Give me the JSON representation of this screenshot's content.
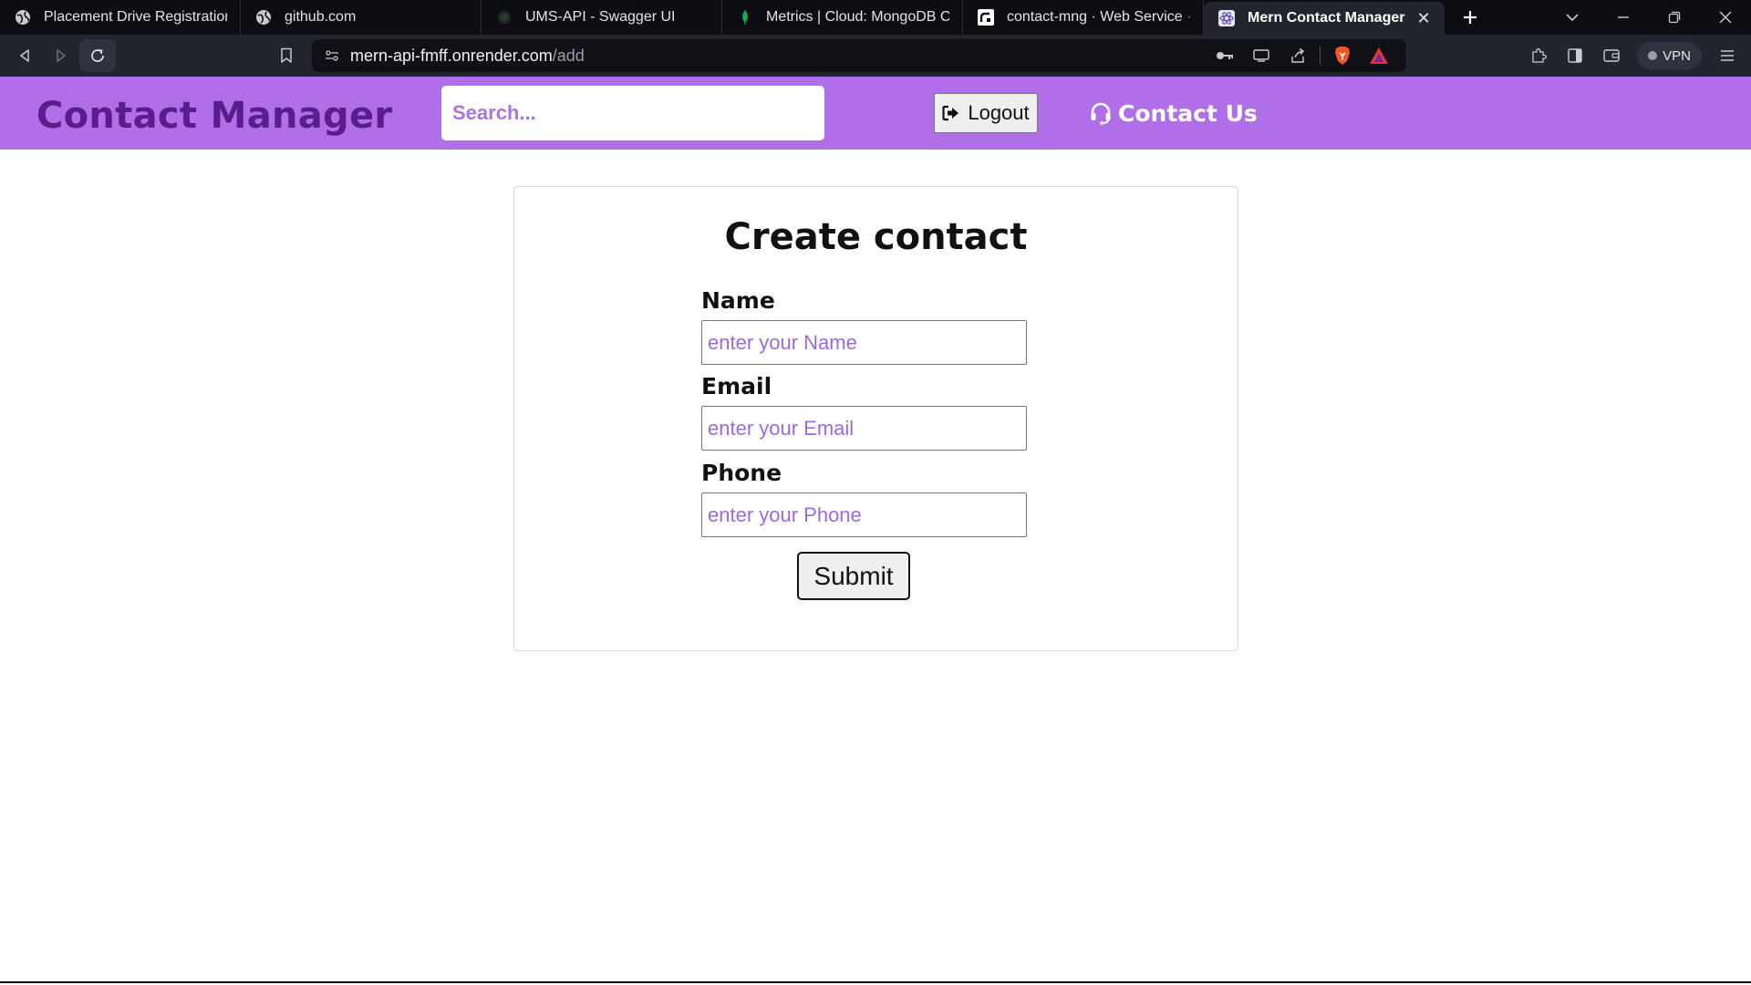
{
  "browser": {
    "tabs": [
      {
        "title": "Placement Drive Registration",
        "icon": "globe-icon"
      },
      {
        "title": "github.com",
        "icon": "globe-icon"
      },
      {
        "title": "UMS-API - Swagger UI",
        "icon": "swagger-icon"
      },
      {
        "title": "Metrics | Cloud: MongoDB Cloud",
        "icon": "mongodb-leaf-icon"
      },
      {
        "title": "contact-mng · Web Service · Re",
        "icon": "render-icon"
      },
      {
        "title": "Mern Contact Manager",
        "icon": "react-icon",
        "active": true
      }
    ],
    "url_host": "mern-api-fmff.onrender.com",
    "url_path": "/add",
    "vpn_label": "VPN"
  },
  "navbar": {
    "brand": "Contact Manager",
    "search_placeholder": "Search...",
    "logout_label": "Logout",
    "contact_label": "Contact Us"
  },
  "form": {
    "title": "Create contact",
    "name_label": "Name",
    "name_placeholder": "enter your Name",
    "email_label": "Email",
    "email_placeholder": "enter your Email",
    "phone_label": "Phone",
    "phone_placeholder": "enter your Phone",
    "submit_label": "Submit"
  },
  "colors": {
    "navbar_bg": "#b06ee8",
    "brand_text": "#5a1d8c",
    "placeholder": "#9a6ae0"
  }
}
